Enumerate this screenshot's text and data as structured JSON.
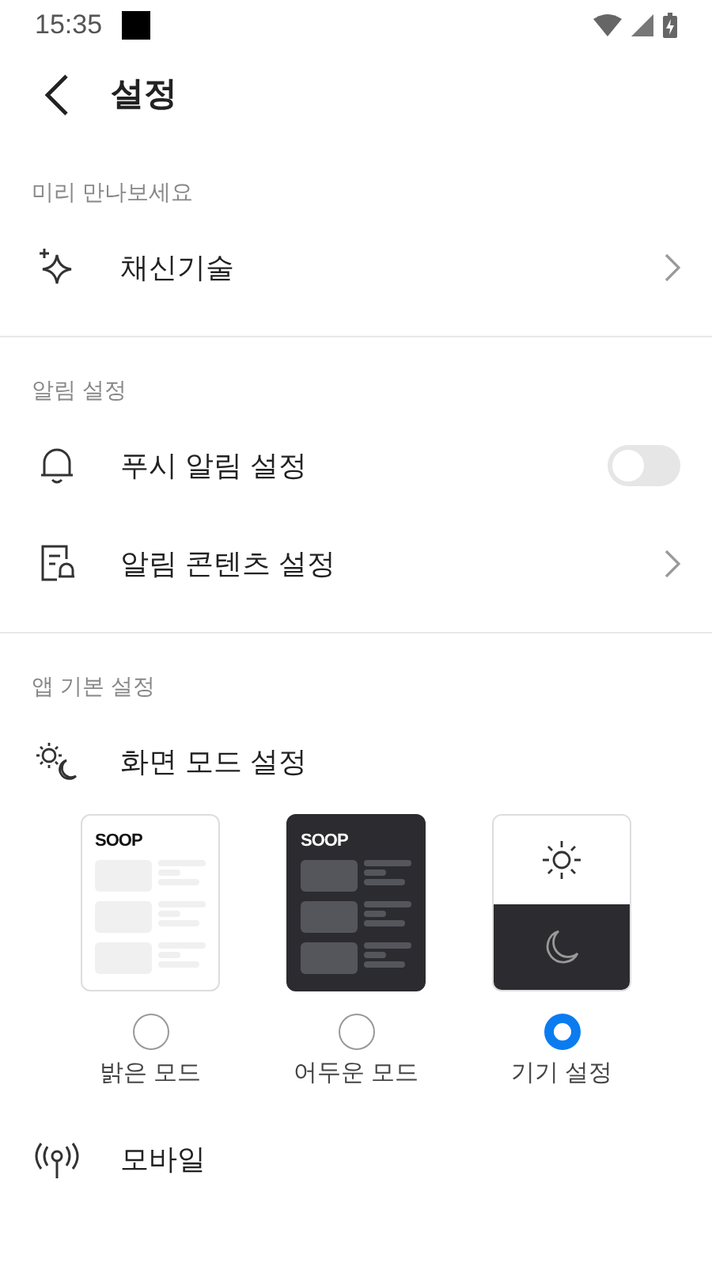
{
  "status_bar": {
    "time": "15:35"
  },
  "header": {
    "title": "설정"
  },
  "sections": [
    {
      "title": "미리 만나보세요",
      "rows": [
        {
          "kind": "link",
          "label": "채신기술"
        }
      ]
    },
    {
      "title": "알림 설정",
      "rows": [
        {
          "kind": "toggle",
          "label": "푸시 알림 설정",
          "on": false
        },
        {
          "kind": "link",
          "label": "알림 콘텐츠 설정"
        }
      ]
    },
    {
      "title": "앱 기본 설정",
      "rows": [
        {
          "kind": "modes",
          "label": "화면 모드 설정",
          "modes": [
            {
              "kind": "light",
              "logo": "SOOP",
              "label": "밝은 모드",
              "selected": false
            },
            {
              "kind": "dark",
              "logo": "SOOP",
              "label": "어두운 모드",
              "selected": false
            },
            {
              "kind": "system",
              "label": "기기 설정",
              "selected": true
            }
          ]
        },
        {
          "kind": "plain",
          "label": "모바일"
        }
      ]
    }
  ]
}
